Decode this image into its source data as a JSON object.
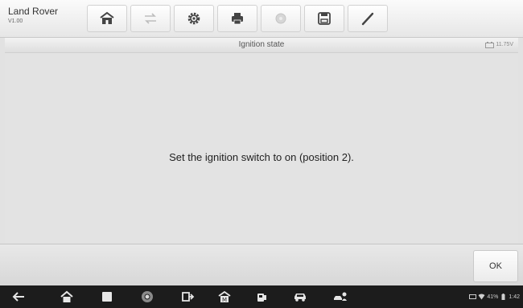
{
  "app": {
    "vehicle_name": "Land Rover",
    "version": "V1.00"
  },
  "toolbar": {
    "buttons": [
      {
        "icon": "home-icon",
        "enabled": true
      },
      {
        "icon": "vehicle-swap-icon",
        "enabled": false
      },
      {
        "icon": "gear-icon",
        "enabled": true
      },
      {
        "icon": "printer-icon",
        "enabled": true
      },
      {
        "icon": "help-icon",
        "enabled": false
      },
      {
        "icon": "save-icon",
        "enabled": true
      },
      {
        "icon": "pen-icon",
        "enabled": true
      }
    ]
  },
  "header": {
    "title": "Ignition state",
    "battery_voltage": "11.75V"
  },
  "main": {
    "message": "Set the ignition switch to on (position 2)."
  },
  "footer": {
    "ok_label": "OK"
  },
  "android_nav": {
    "items": [
      "back-icon",
      "home-icon",
      "recent-apps-icon",
      "chrome-icon",
      "vci-connect-icon",
      "maxisys-home-icon",
      "car-service-icon",
      "car-icon",
      "remote-service-icon"
    ]
  },
  "status_bar": {
    "battery": "41%",
    "time": "1:42"
  },
  "colors": {
    "background": "#e2e2e2",
    "navbar": "#1c1c1c",
    "text": "#222222"
  }
}
